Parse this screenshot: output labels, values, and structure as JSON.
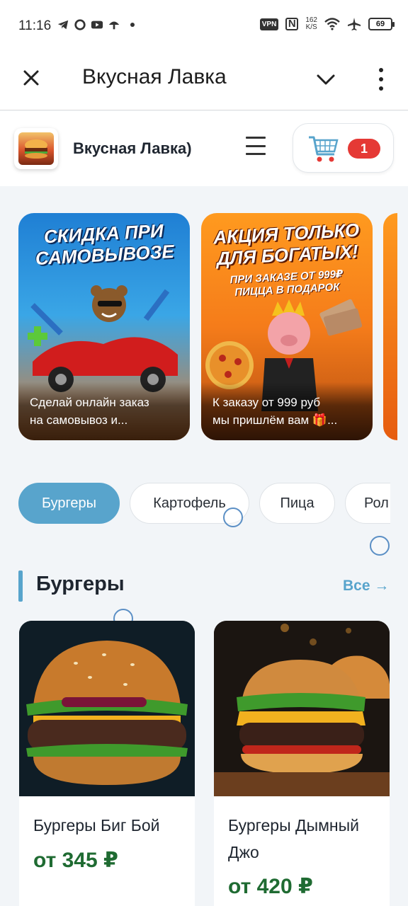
{
  "status_bar": {
    "time": "11:16",
    "left_icons": [
      "telegram-icon",
      "chat-icon",
      "youtube-icon",
      "mushroom-icon",
      "dot-icon"
    ],
    "vpn": "VPN",
    "nfc": "N",
    "speed_value": "162",
    "speed_unit": "K/S",
    "battery": "69"
  },
  "app_bar": {
    "title": "Вкусная Лавка"
  },
  "site_header": {
    "shop_name": "Вкусная Лавка)",
    "cart_count": "1"
  },
  "banners": [
    {
      "headline": "Скидка при самовывозе",
      "sub": "",
      "caption_line1": "Сделай онлайн заказ",
      "caption_line2": "на самовывоз и..."
    },
    {
      "headline": "Акция только для богатых!",
      "sub": "При заказе от 999₽ пицца в подарок",
      "caption_line1": "К заказу от 999 руб",
      "caption_line2": "мы пришлём вам 🎁..."
    }
  ],
  "categories": [
    {
      "label": "Бургеры",
      "active": true
    },
    {
      "label": "Картофель",
      "active": false
    },
    {
      "label": "Пица",
      "active": false
    },
    {
      "label": "Рол",
      "active": false
    }
  ],
  "section": {
    "title": "Бургеры",
    "see_all": "Все →"
  },
  "products": [
    {
      "name": "Бургеры Биг Бой",
      "price": "от 345 ₽"
    },
    {
      "name": "Бургеры Дымный Джо",
      "price": "от 420 ₽"
    }
  ],
  "colors": {
    "accent": "#58a4cc",
    "price": "#1f6b32",
    "badge": "#e53935"
  }
}
